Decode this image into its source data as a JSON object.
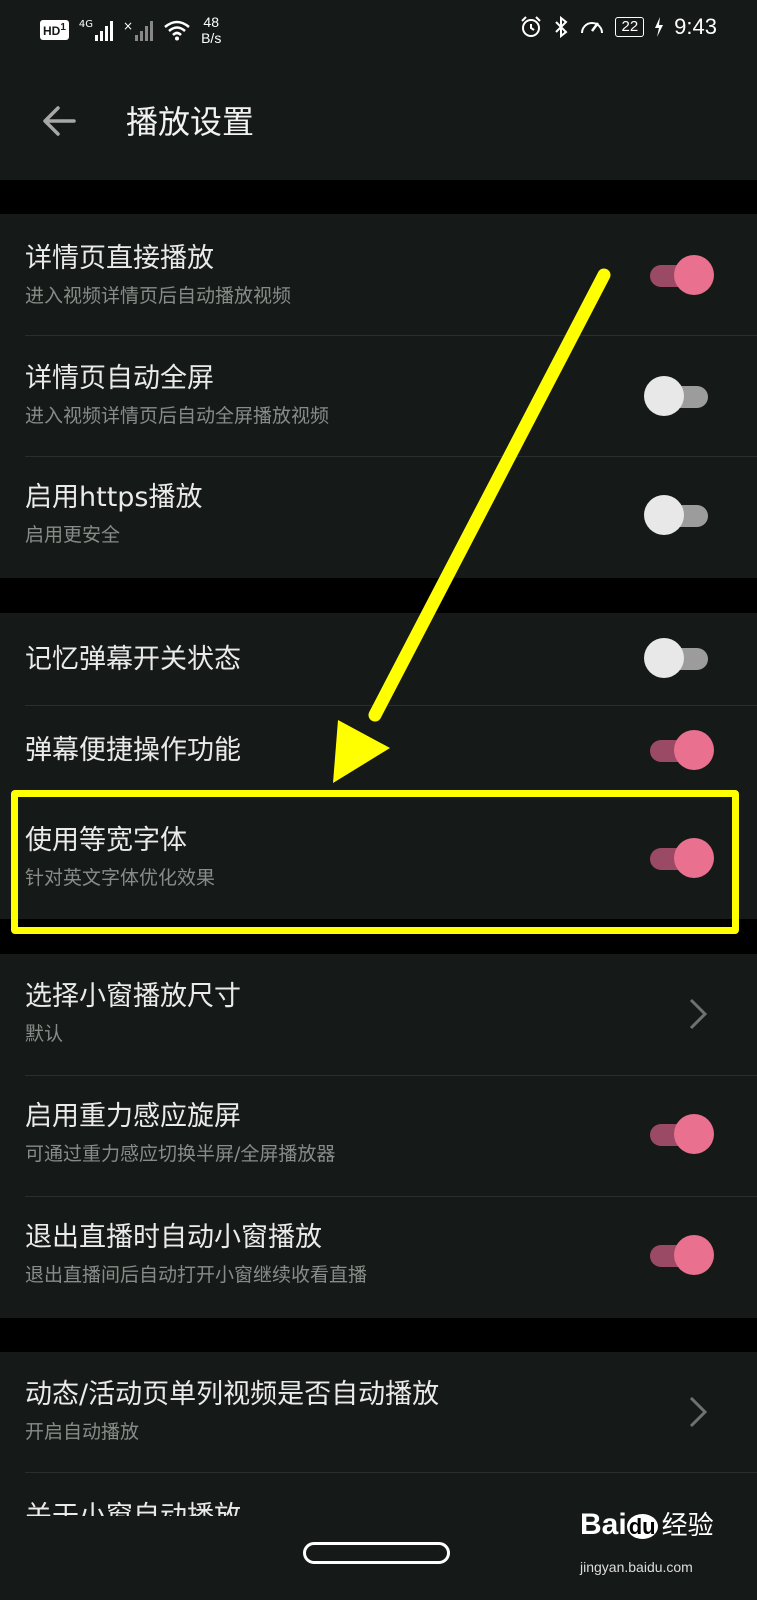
{
  "status_bar": {
    "hd_label": "HD",
    "sim_label": "1",
    "network_label": "4G",
    "no_signal_label": "×",
    "speed_value": "48",
    "speed_unit": "B/s",
    "battery": "22",
    "time": "9:43",
    "icons": [
      "alarm-icon",
      "bluetooth-icon",
      "data-speed-icon",
      "battery-icon",
      "charging-icon"
    ]
  },
  "header": {
    "title": "播放设置",
    "back_icon": "arrow-left-icon"
  },
  "sections": [
    {
      "items": [
        {
          "title": "详情页直接播放",
          "subtitle": "进入视频详情页后自动播放视频",
          "control": "toggle",
          "on": true
        },
        {
          "title": "详情页自动全屏",
          "subtitle": "进入视频详情页后自动全屏播放视频",
          "control": "toggle",
          "on": false
        },
        {
          "title": "启用https播放",
          "subtitle": "启用更安全",
          "control": "toggle",
          "on": false
        }
      ]
    },
    {
      "items": [
        {
          "title": "记忆弹幕开关状态",
          "subtitle": "",
          "control": "toggle",
          "on": false
        },
        {
          "title": "弹幕便捷操作功能",
          "subtitle": "",
          "control": "toggle",
          "on": true
        },
        {
          "title": "使用等宽字体",
          "subtitle": "针对英文字体优化效果",
          "control": "toggle",
          "on": true
        }
      ]
    },
    {
      "items": [
        {
          "title": "选择小窗播放尺寸",
          "subtitle": "默认",
          "control": "chevron"
        },
        {
          "title": "启用重力感应旋屏",
          "subtitle": "可通过重力感应切换半屏/全屏播放器",
          "control": "toggle",
          "on": true
        },
        {
          "title": "退出直播时自动小窗播放",
          "subtitle": "退出直播间后自动打开小窗继续收看直播",
          "control": "toggle",
          "on": true
        }
      ]
    },
    {
      "items": [
        {
          "title": "动态/活动页单列视频是否自动播放",
          "subtitle": "开启自动播放",
          "control": "chevron"
        },
        {
          "title": "关于小窗自动播放",
          "subtitle": "",
          "control": "none"
        }
      ]
    }
  ],
  "annotation": {
    "highlight_color": "#ffff00",
    "arrow_color": "#ffff00"
  },
  "colors": {
    "background": "#000000",
    "surface": "#151917",
    "toggle_on_knob": "#e9708f",
    "toggle_on_track": "#9a4a64",
    "toggle_off_knob": "#e8e8e8",
    "toggle_off_track": "#9c9c9c"
  },
  "watermark": {
    "brand": "Bai",
    "brand_suffix": "du",
    "product": "经验",
    "url": "jingyan.baidu.com"
  }
}
